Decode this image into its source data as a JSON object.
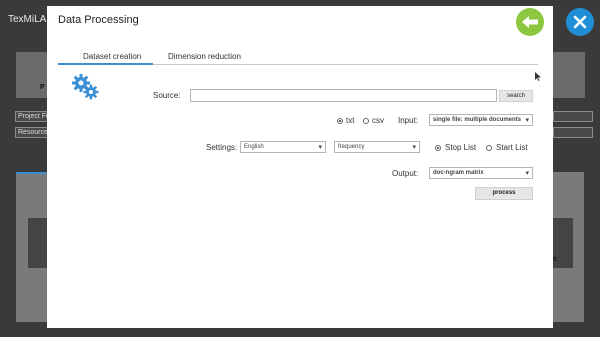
{
  "background_app": {
    "title": "TexMiLAB",
    "tile_text_left": "P",
    "tile_text_right": "n",
    "fields": [
      "Project Fi",
      "Resource"
    ]
  },
  "dialog": {
    "title": "Data Processing",
    "tabs": [
      {
        "label": "Dataset creation",
        "active": true
      },
      {
        "label": "Dimension reduction",
        "active": false
      }
    ],
    "source": {
      "label": "Source:",
      "value": "",
      "button": "search"
    },
    "format": {
      "options": [
        {
          "label": "txt",
          "selected": true
        },
        {
          "label": "csv",
          "selected": false
        }
      ],
      "input_label": "Input:",
      "input_value": "single file: multiple documents"
    },
    "settings": {
      "label": "Settings:",
      "language": "English",
      "weighting": "frequency",
      "list_options": [
        {
          "label": "Stop List",
          "selected": true
        },
        {
          "label": "Start List",
          "selected": false
        }
      ]
    },
    "output": {
      "label": "Output:",
      "value": "doc-ngram matrix"
    },
    "process_button": "process"
  },
  "colors": {
    "back_button": "#8dc63f",
    "close_button": "#1e8fd6",
    "tab_accent": "#3b8fd4"
  },
  "icons": {
    "back": "arrow-left-icon",
    "close": "close-icon",
    "settings": "gears-icon"
  }
}
